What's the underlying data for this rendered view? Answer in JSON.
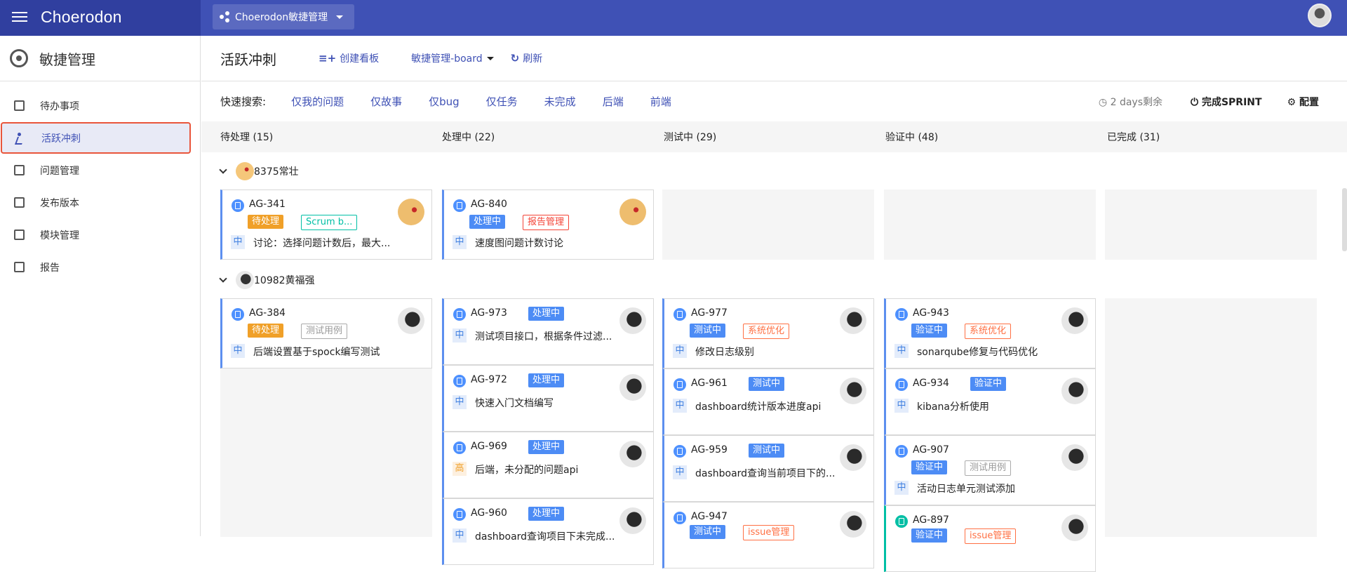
{
  "topbar": {
    "brand": "Choerodon",
    "project": "Choerodon敏捷管理"
  },
  "sidebar": {
    "title": "敏捷管理",
    "items": [
      {
        "label": "待办事项",
        "icon": "list-icon"
      },
      {
        "label": "活跃冲刺",
        "icon": "run-icon",
        "active": true
      },
      {
        "label": "问题管理",
        "icon": "clipboard-icon"
      },
      {
        "label": "发布版本",
        "icon": "send-icon"
      },
      {
        "label": "模块管理",
        "icon": "puzzle-icon"
      },
      {
        "label": "报告",
        "icon": "report-icon"
      }
    ]
  },
  "header": {
    "title": "活跃冲刺",
    "create_board": "创建看板",
    "board_select": "敏捷管理-board",
    "refresh": "刷新"
  },
  "filters": {
    "label": "快速搜索:",
    "items": [
      "仅我的问题",
      "仅故事",
      "仅bug",
      "仅任务",
      "未完成",
      "后端",
      "前端"
    ],
    "days_left": "2 days剩余",
    "complete": "完成SPRINT",
    "config": "配置"
  },
  "columns": [
    "待处理 (15)",
    "处理中 (22)",
    "测试中 (29)",
    "验证中 (48)",
    "已完成 (31)"
  ],
  "swimlanes": [
    {
      "user": "8375常壮",
      "cards": [
        {
          "col": 0,
          "id": "AG-341",
          "status": "待处理",
          "tag": "Scrum b...",
          "priority": "中",
          "summary": "讨论：选择问题计数后，最大..."
        },
        {
          "col": 1,
          "id": "AG-840",
          "status": "处理中",
          "tag": "报告管理",
          "priority": "中",
          "summary": "速度图问题计数讨论"
        }
      ]
    },
    {
      "user": "10982黄福强",
      "cards": [
        {
          "col": 0,
          "id": "AG-384",
          "status": "待处理",
          "tag": "测试用例",
          "priority": "中",
          "summary": "后端设置基于spock编写测试"
        },
        {
          "col": 1,
          "id": "AG-973",
          "status": "处理中",
          "priority": "中",
          "summary": "测试项目接口，根据条件过滤..."
        },
        {
          "col": 1,
          "id": "AG-972",
          "status": "处理中",
          "priority": "中",
          "summary": "快速入门文档编写"
        },
        {
          "col": 1,
          "id": "AG-969",
          "status": "处理中",
          "priority": "高",
          "summary": "后端，未分配的问题api"
        },
        {
          "col": 1,
          "id": "AG-960",
          "status": "处理中",
          "priority": "中",
          "summary": "dashboard查询项目下未完成..."
        },
        {
          "col": 2,
          "id": "AG-977",
          "status": "测试中",
          "tag": "系统优化",
          "priority": "中",
          "summary": "修改日志级别"
        },
        {
          "col": 2,
          "id": "AG-961",
          "status": "测试中",
          "priority": "中",
          "summary": "dashboard统计版本进度api"
        },
        {
          "col": 2,
          "id": "AG-959",
          "status": "测试中",
          "priority": "中",
          "summary": "dashboard查询当前项目下的..."
        },
        {
          "col": 2,
          "id": "AG-947",
          "status": "测试中",
          "tag": "issue管理",
          "priority": "中",
          "summary": ""
        },
        {
          "col": 3,
          "id": "AG-943",
          "status": "验证中",
          "tag": "系统优化",
          "priority": "中",
          "summary": "sonarqube修复与代码优化"
        },
        {
          "col": 3,
          "id": "AG-934",
          "status": "验证中",
          "priority": "中",
          "summary": "kibana分析使用"
        },
        {
          "col": 3,
          "id": "AG-907",
          "status": "验证中",
          "tag": "测试用例",
          "priority": "中",
          "summary": "活动日志单元测试添加"
        },
        {
          "col": 3,
          "id": "AG-897",
          "status": "验证中",
          "tag": "issue管理",
          "priority": "中",
          "summary": ""
        }
      ]
    }
  ]
}
